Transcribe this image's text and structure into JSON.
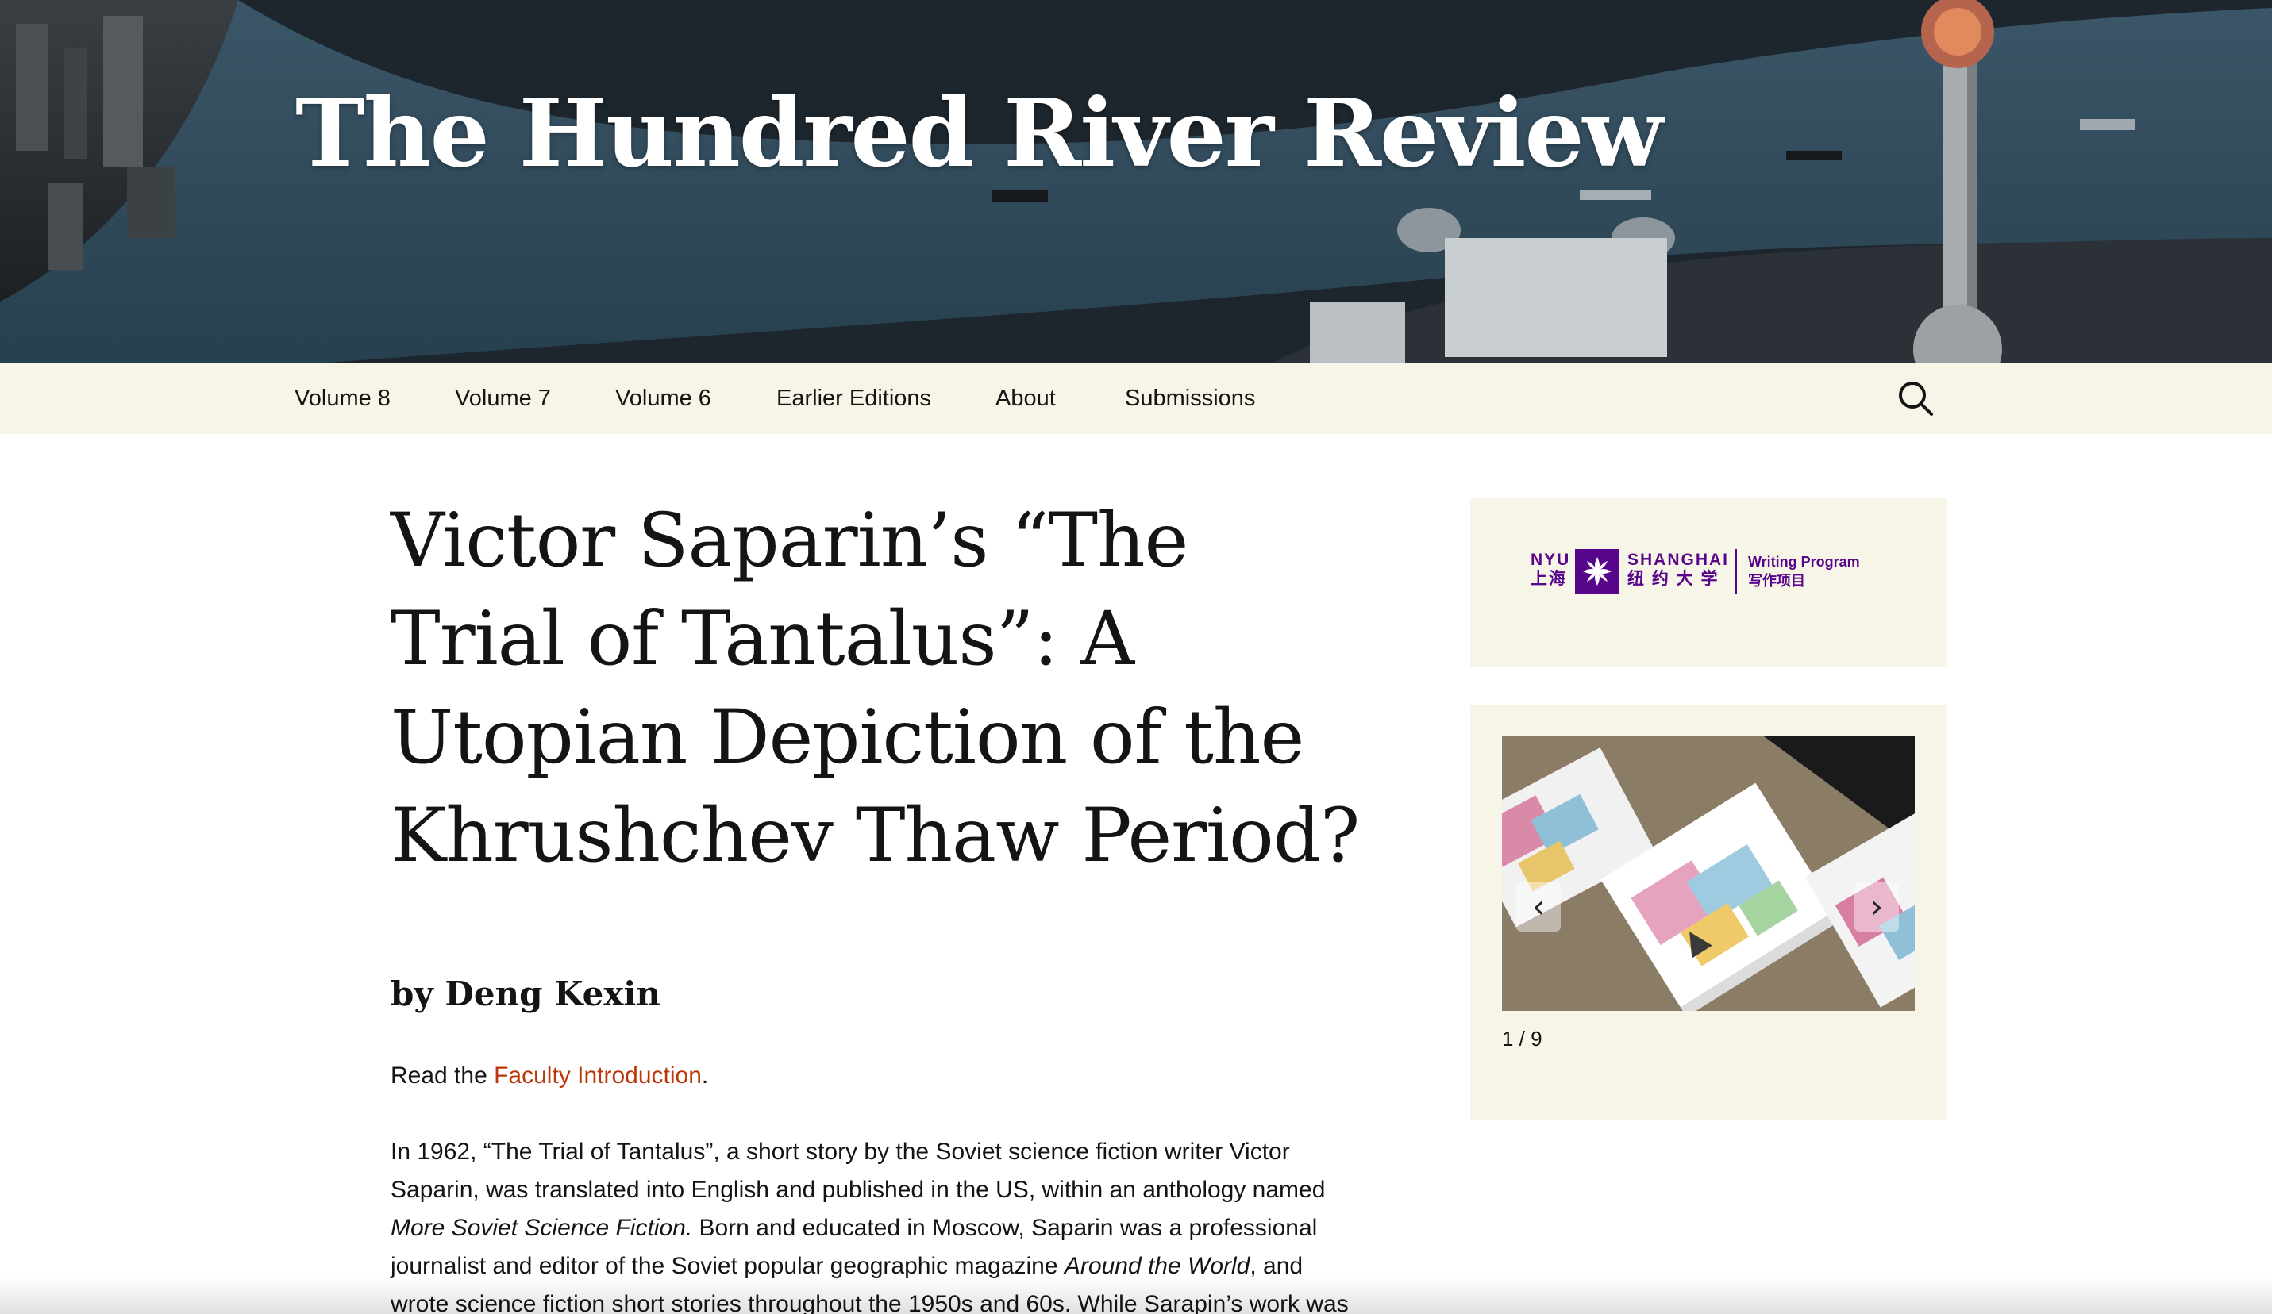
{
  "site": {
    "title": "The Hundred River Review"
  },
  "nav": {
    "items": [
      {
        "label": "Volume 8"
      },
      {
        "label": "Volume 7"
      },
      {
        "label": "Volume 6"
      },
      {
        "label": "Earlier Editions"
      },
      {
        "label": "About"
      },
      {
        "label": "Submissions"
      }
    ],
    "search_icon": "search-icon"
  },
  "article": {
    "title": "Victor Saparin’s “The Trial of Tantalus”: A Utopian Depiction of the Khrushchev Thaw Period?",
    "byline": "by Deng Kexin",
    "read_prefix": "Read the ",
    "read_link": "Faculty Introduction",
    "read_suffix": ".",
    "para1_a": "In 1962, “The Trial of Tantalus”, a short story by the Soviet science fiction writer Victor Saparin, was translated into English and published in the US, within an anthology named ",
    "para1_em1": "More Soviet Science Fiction.",
    "para1_b": " Born and educated in Moscow, Saparin was a professional journalist and editor of the Soviet popular geographic magazine ",
    "para1_em2": "Around the World",
    "para1_c": ", and wrote science fiction short stories throughout the 1950s and 60s. While Sarapin’s work was rela-"
  },
  "sidebar": {
    "logo": {
      "nyu": "NYU",
      "nyu_cn": "上海",
      "shanghai": "SHANGHAI",
      "shanghai_cn": "纽 约 大 学",
      "program": "Writing Program",
      "program_cn": "写作项目"
    },
    "slider": {
      "counter": "1 / 9",
      "prev_glyph": "‹",
      "next_glyph": "›"
    }
  },
  "colors": {
    "link": "#bc360a",
    "nav_bg": "#f7f5e7",
    "widget_bg": "#f7f5e7",
    "nyu_purple": "#57068c"
  }
}
